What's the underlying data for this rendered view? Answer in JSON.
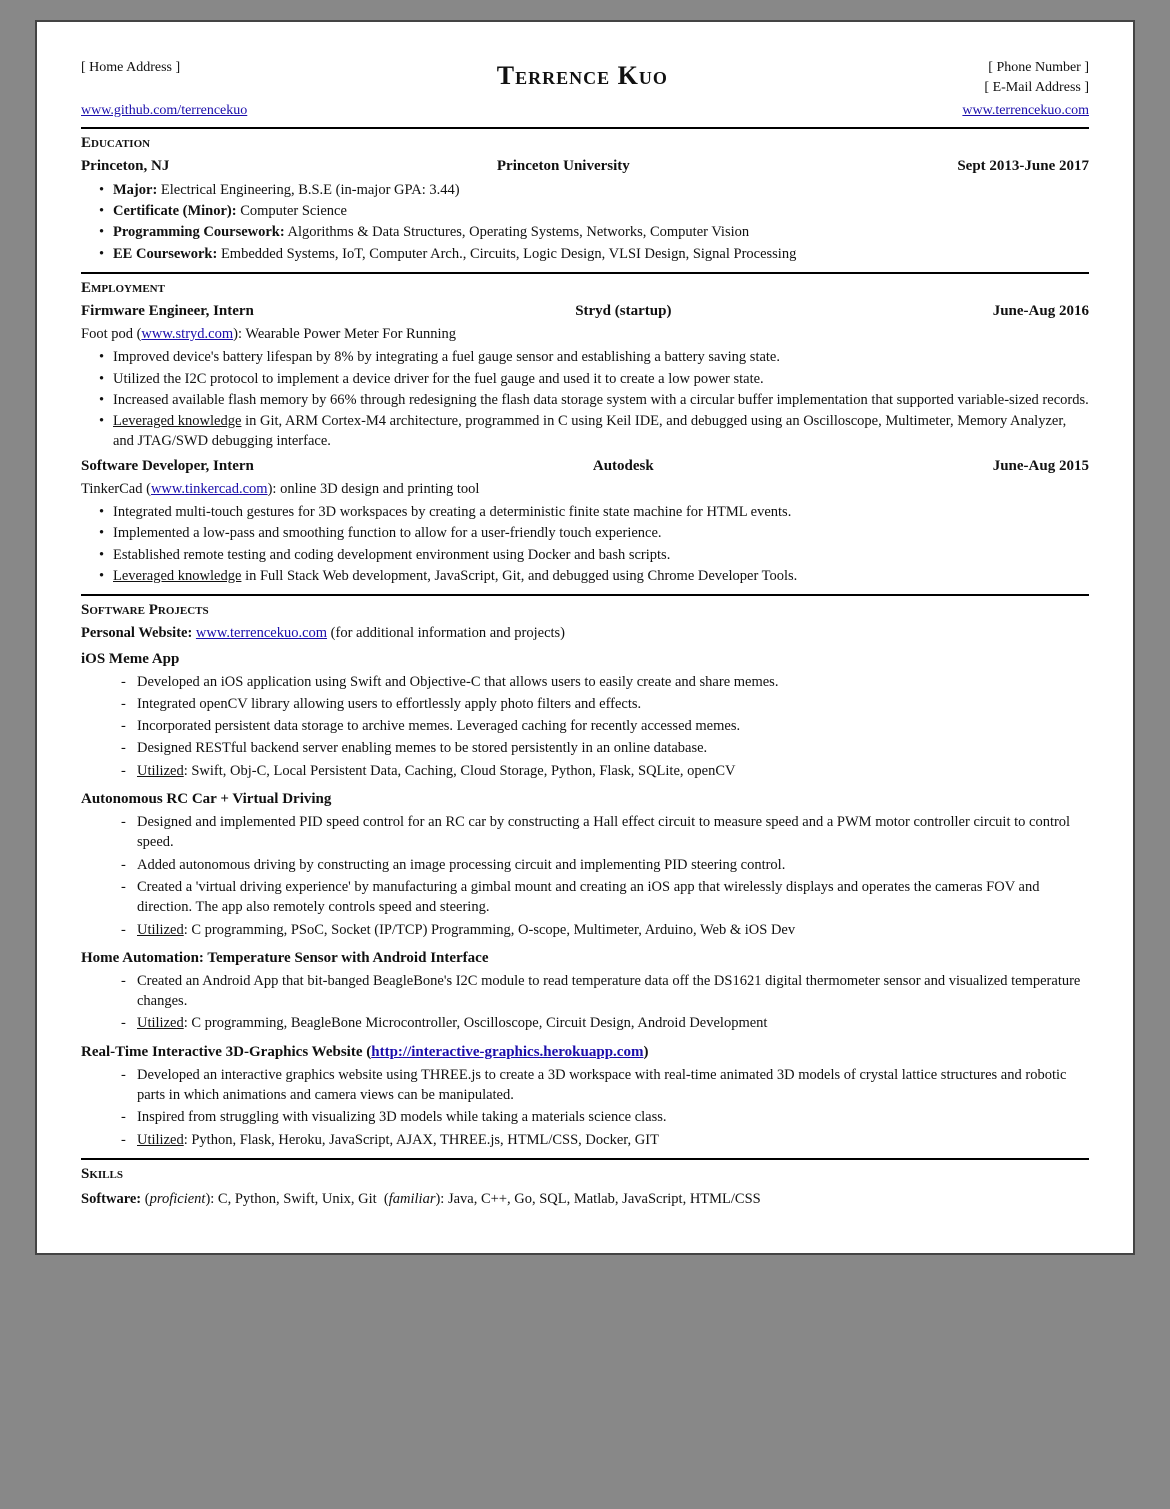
{
  "header": {
    "address": "[ Home Address ]",
    "phone": "[ Phone Number ]",
    "email": "[ E-Mail Address ]",
    "name": "Terrence Kuo",
    "github": "www.github.com/terrencekuo",
    "website": "www.terrencekuo.com"
  },
  "education": {
    "label": "Education",
    "location": "Princeton, NJ",
    "university": "Princeton University",
    "dates": "Sept 2013-June 2017",
    "bullets": [
      "<strong>Major:</strong> Electrical Engineering, B.S.E (in-major GPA: 3.44)",
      "<strong>Certificate (Minor):</strong> Computer Science",
      "<strong>Programming Coursework:</strong> Algorithms &amp; Data Structures, Operating Systems, Networks, Computer Vision",
      "<strong>EE Coursework:</strong> Embedded Systems, IoT, Computer Arch., Circuits, Logic Design, VLSI Design, Signal Processing"
    ]
  },
  "employment": {
    "label": "Employment",
    "jobs": [
      {
        "title": "Firmware Engineer, Intern",
        "company": "Stryd (startup)",
        "dates": "June-Aug 2016",
        "subtitle_pre": "Foot pod (",
        "subtitle_link": "www.stryd.com",
        "subtitle_link_href": "http://www.stryd.com",
        "subtitle_post": "): Wearable Power Meter For Running",
        "bullets": [
          "Improved device's battery lifespan by 8% by integrating a fuel gauge sensor and establishing a battery saving state.",
          "Utilized the I2C protocol to implement a device driver for the fuel gauge and used it to create a low power state.",
          "Increased available flash memory by 66% through redesigning the flash data storage system with a circular buffer implementation that supported variable-sized records.",
          "<span class='underline'>Leveraged knowledge</span> in Git, ARM Cortex-M4 architecture, programmed in C using Keil IDE, and debugged using an Oscilloscope, Multimeter, Memory Analyzer, and JTAG/SWD debugging interface."
        ]
      },
      {
        "title": "Software Developer, Intern",
        "company": "Autodesk",
        "dates": "June-Aug 2015",
        "subtitle_pre": "TinkerCad (",
        "subtitle_link": "www.tinkercad.com",
        "subtitle_link_href": "http://www.tinkercad.com",
        "subtitle_post": "): online 3D design and printing tool",
        "bullets": [
          "Integrated multi-touch gestures for 3D workspaces by creating a deterministic finite state machine for HTML events.",
          "Implemented a low-pass and smoothing function to allow for a user-friendly touch experience.",
          "Established remote testing and coding development environment using Docker and bash scripts.",
          "<span class='underline'>Leveraged knowledge</span> in Full Stack Web development, JavaScript, Git, and debugged using Chrome Developer Tools."
        ]
      }
    ]
  },
  "software_projects": {
    "label": "Software Projects",
    "personal_website_pre": "Personal Website: ",
    "personal_website_link": "www.terrencekuo.com",
    "personal_website_href": "http://www.terrencekuo.com",
    "personal_website_post": " (for additional information and projects)",
    "projects": [
      {
        "title": "iOS Meme App",
        "bullets": [
          "Developed an iOS application using Swift and Objective-C that allows users to easily create and share memes.",
          "Integrated openCV library allowing users to effortlessly apply photo filters and effects.",
          "Incorporated persistent data storage to archive memes. Leveraged caching for recently accessed memes.",
          "Designed RESTful backend server enabling memes to be stored persistently in an online database.",
          "<span class='underline'>Utilized</span>: Swift, Obj-C, Local Persistent Data, Caching, Cloud Storage, Python, Flask, SQLite, openCV"
        ]
      },
      {
        "title": "Autonomous RC Car + Virtual Driving",
        "bullets": [
          "Designed and implemented PID speed control for an RC car by constructing a Hall effect circuit to measure speed and a PWM motor controller circuit to control speed.",
          "Added autonomous driving by constructing an image processing circuit and implementing PID steering control.",
          "Created a 'virtual driving experience' by manufacturing a gimbal mount and creating an iOS app that wirelessly displays and operates the cameras FOV and direction. The app also remotely controls speed and steering.",
          "<span class='underline'>Utilized</span>: C programming, PSoC, Socket (IP/TCP) Programming, O-scope, Multimeter, Arduino, Web &amp; iOS Dev"
        ]
      },
      {
        "title": "Home Automation: Temperature Sensor with Android Interface",
        "bullets": [
          "Created an Android App that bit-banged BeagleBone's I2C module to read temperature data off the DS1621 digital thermometer sensor and visualized temperature changes.",
          "<span class='underline'>Utilized</span>: C programming, BeagleBone Microcontroller, Oscilloscope, Circuit Design, Android Development"
        ]
      },
      {
        "title": "Real-Time Interactive 3D-Graphics Website",
        "title_link": "http://interactive-graphics.herokuapp.com",
        "title_link_text": "http://interactive-graphics.herokuapp.com",
        "bullets": [
          "Developed an interactive graphics website using THREE.js to create a 3D workspace with real-time animated 3D models of crystal lattice structures and robotic parts in which animations and camera views can be manipulated.",
          "Inspired from struggling with visualizing 3D models while taking a materials science class.",
          "<span class='underline'>Utilized</span>: Python, Flask, Heroku, JavaScript, AJAX, THREE.js, HTML/CSS, Docker, GIT"
        ]
      }
    ]
  },
  "skills": {
    "label": "Skills",
    "software": "Software: (proficient): C, Python, Swift, Unix, Git (familiar): Java, C++, Go, SQL, Matlab, JavaScript, HTML/CSS"
  }
}
